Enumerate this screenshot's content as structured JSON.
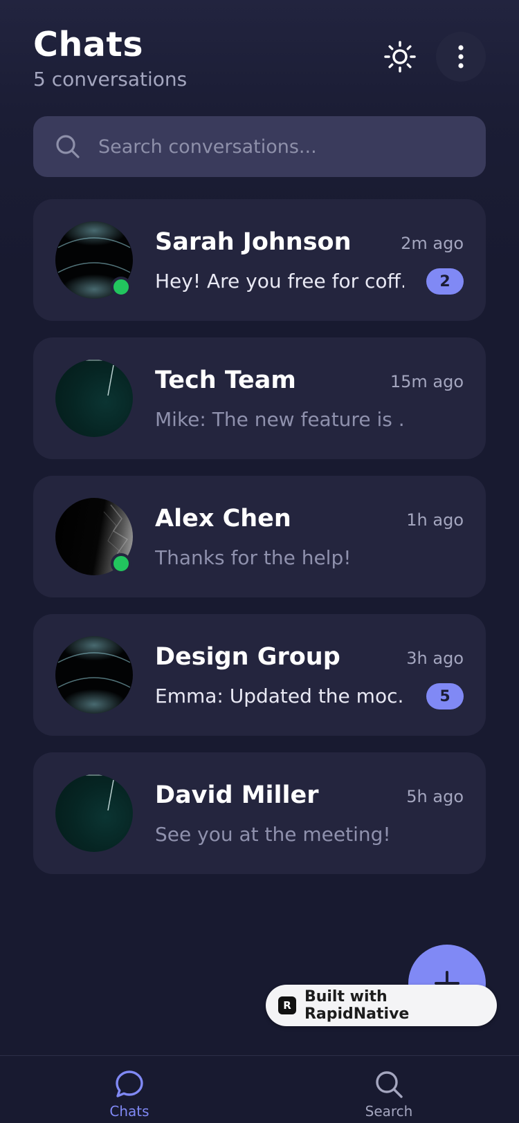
{
  "header": {
    "title": "Chats",
    "subtitle": "5 conversations"
  },
  "search": {
    "placeholder": "Search conversations..."
  },
  "chats": [
    {
      "name": "Sarah Johnson",
      "time": "2m ago",
      "preview": "Hey! Are you free for coff...",
      "unread": "2",
      "online": true
    },
    {
      "name": "Tech Team",
      "time": "15m ago",
      "preview": "Mike: The new feature is ...",
      "unread": "",
      "online": false
    },
    {
      "name": "Alex Chen",
      "time": "1h ago",
      "preview": "Thanks for the help!",
      "unread": "",
      "online": true
    },
    {
      "name": "Design Group",
      "time": "3h ago",
      "preview": "Emma: Updated the moc...",
      "unread": "5",
      "online": false
    },
    {
      "name": "David Miller",
      "time": "5h ago",
      "preview": "See you at the meeting!",
      "unread": "",
      "online": false
    }
  ],
  "badge": {
    "logo": "R",
    "text": "Built with RapidNative"
  },
  "tabs": [
    {
      "label": "Chats",
      "icon": "chat-bubble-icon",
      "active": true
    },
    {
      "label": "Search",
      "icon": "search-icon",
      "active": false
    }
  ],
  "colors": {
    "accent": "#8089f5",
    "online": "#22c55e",
    "background": "#181a30",
    "card": "#24253e",
    "search_field": "#3a3b5c"
  }
}
